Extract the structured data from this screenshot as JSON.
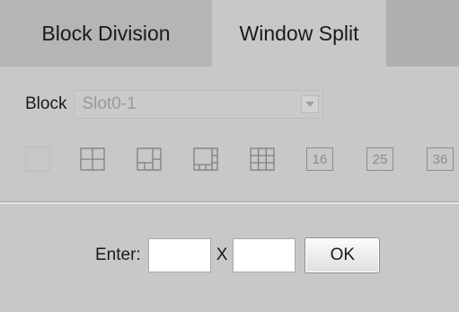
{
  "tabs": [
    {
      "label": "Block Division"
    },
    {
      "label": "Window Split"
    }
  ],
  "block": {
    "label": "Block",
    "selected": "Slot0-1"
  },
  "split_modes": [
    {
      "icon": "blank-split-icon"
    },
    {
      "icon": "grid-2x2-icon"
    },
    {
      "icon": "grid-1plus5-icon"
    },
    {
      "icon": "grid-1plus7-icon"
    },
    {
      "icon": "grid-3x3-icon"
    },
    {
      "label": "16"
    },
    {
      "label": "25"
    },
    {
      "label": "36"
    }
  ],
  "custom": {
    "enter_label": "Enter:",
    "x_label": "X",
    "rows_value": "",
    "cols_value": "",
    "ok_label": "OK"
  },
  "colors": {
    "background": "#c8c8c8",
    "tab_inactive": "#b5b5b5",
    "icon_stroke": "#7f7f7f"
  }
}
